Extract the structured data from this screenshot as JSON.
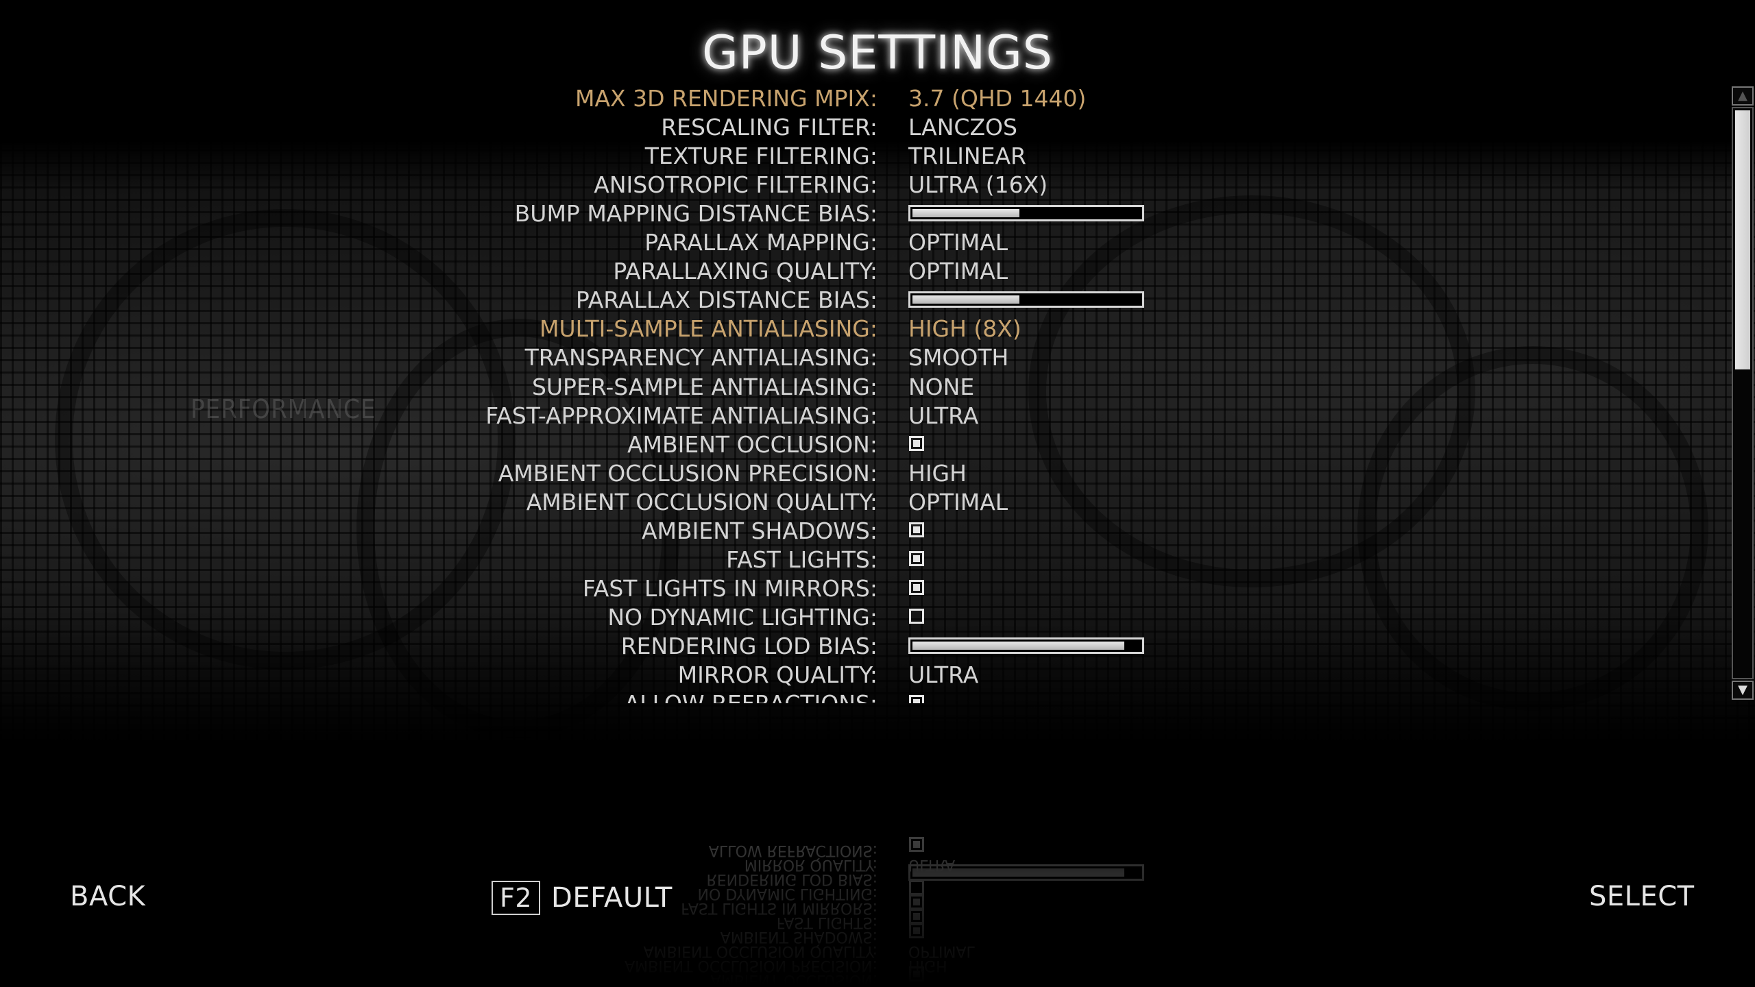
{
  "title": "GPU SETTINGS",
  "settings": [
    {
      "label": "MAX 3D RENDERING MPIX",
      "type": "value",
      "value": "3.7 (QHD 1440)",
      "highlight": true
    },
    {
      "label": "RESCALING FILTER",
      "type": "value",
      "value": "LANCZOS"
    },
    {
      "label": "TEXTURE FILTERING",
      "type": "value",
      "value": "TRILINEAR"
    },
    {
      "label": "ANISOTROPIC FILTERING",
      "type": "value",
      "value": "ULTRA (16X)"
    },
    {
      "label": "BUMP MAPPING DISTANCE BIAS",
      "type": "slider",
      "level": 0.47
    },
    {
      "label": "PARALLAX MAPPING",
      "type": "value",
      "value": "OPTIMAL"
    },
    {
      "label": "PARALLAXING QUALITY",
      "type": "value",
      "value": "OPTIMAL"
    },
    {
      "label": "PARALLAX DISTANCE BIAS",
      "type": "slider",
      "level": 0.47
    },
    {
      "label": "MULTI-SAMPLE ANTIALIASING",
      "type": "value",
      "value": "HIGH (8X)",
      "highlight": true
    },
    {
      "label": "TRANSPARENCY ANTIALIASING",
      "type": "value",
      "value": "SMOOTH"
    },
    {
      "label": "SUPER-SAMPLE ANTIALIASING",
      "type": "value",
      "value": "NONE"
    },
    {
      "label": "FAST-APPROXIMATE ANTIALIASING",
      "type": "value",
      "value": "ULTRA"
    },
    {
      "label": "AMBIENT OCCLUSION",
      "type": "checkbox",
      "checked": true
    },
    {
      "label": "AMBIENT OCCLUSION PRECISION",
      "type": "value",
      "value": "HIGH"
    },
    {
      "label": "AMBIENT OCCLUSION QUALITY",
      "type": "value",
      "value": "OPTIMAL"
    },
    {
      "label": "AMBIENT SHADOWS",
      "type": "checkbox",
      "checked": true
    },
    {
      "label": "FAST LIGHTS",
      "type": "checkbox",
      "checked": true
    },
    {
      "label": "FAST LIGHTS IN MIRRORS",
      "type": "checkbox",
      "checked": true
    },
    {
      "label": "NO DYNAMIC LIGHTING",
      "type": "checkbox",
      "checked": false
    },
    {
      "label": "RENDERING LOD BIAS",
      "type": "slider",
      "level": 0.93
    },
    {
      "label": "MIRROR QUALITY",
      "type": "value",
      "value": "ULTRA"
    },
    {
      "label": "ALLOW REFRACTIONS",
      "type": "checkbox",
      "checked": true
    }
  ],
  "scrollbar": {
    "up_icon": "▲",
    "down_icon": "▼",
    "position": 0.0,
    "visible_fraction": 0.45
  },
  "background_panel": {
    "title": "PERFORMANCE"
  },
  "footer": {
    "back_label": "BACK",
    "default_key": "F2",
    "default_label": "DEFAULT",
    "select_label": "SELECT"
  },
  "colors": {
    "text": "#d4d4d4",
    "highlight": "#c8a36e",
    "background": "#000000"
  }
}
